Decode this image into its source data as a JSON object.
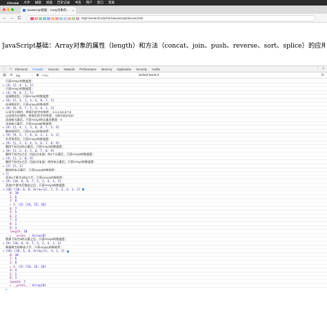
{
  "menubar": {
    "items": [
      "Chrome",
      "文件",
      "编辑",
      "视图",
      "历史记录",
      "书签",
      "用户",
      "窗口",
      "帮助"
    ]
  },
  "tab": {
    "title": "JavaScript基础：Array对象的...",
    "close": "×"
  },
  "nav": {
    "back": "←",
    "forward": "→",
    "reload": "C",
    "url_tail": "/MyFirstHtmlCode/htmlJavaScript/demo6.html",
    "pixel_colors": [
      "#e05a66",
      "#f2a2b0",
      "#8fd19e",
      "#7cc6e8",
      "#b9a1e6",
      "#f0c27a",
      "#e89ab6",
      "#9fd8cb",
      "#c6c6f0",
      "#e3b7a0",
      "#a8d8a0",
      "#d9a0c8"
    ]
  },
  "page": {
    "heading": "JavaScript基础：Array对象的属性（length）和方法（concat、join、push、reverse、sort、splice）的应用"
  },
  "devtools": {
    "tabs": [
      "Elements",
      "Console",
      "Sources",
      "Network",
      "Performance",
      "Memory",
      "Application",
      "Security",
      "Audits"
    ],
    "active_tab": "Console",
    "context": "top",
    "filter_placeholder": "Filter",
    "levels": "Default levels ▾"
  },
  "console": {
    "rows": [
      {
        "kind": "msg",
        "text": "只获Array1的数据是："
      },
      {
        "kind": "obj",
        "tri": "▸",
        "text": "(4) [2, 4, 1, 3]"
      },
      {
        "kind": "msg",
        "text": "只获Array2的数据是："
      },
      {
        "kind": "obj",
        "tri": "▸",
        "text": "(4) [6, 8, 7, 5]"
      },
      {
        "kind": "msg",
        "text": "连接数组后，只获Array3的数据是："
      },
      {
        "kind": "obj",
        "tri": "▸",
        "text": "(8) [2, 4, 1, 3, 6, 8, 7, 5]"
      },
      {
        "kind": "msg",
        "text": "连接数组后，只获Array4的数据是："
      },
      {
        "kind": "obj",
        "tri": "▸",
        "text": "(8) [6, 8, 7, 5, 2, 4, 1, 3]"
      },
      {
        "kind": "msg",
        "text": "以逗号分隔符，拼接后的字符串是：  2,4,1,3,6,8,7,5"
      },
      {
        "kind": "msg",
        "text": "以竖线为分隔符，拼接后的字符串是：  6|8|7|5|2|4|1|3"
      },
      {
        "kind": "msg",
        "text": "添加新元素后，只获Array3的元素总数是：9"
      },
      {
        "kind": "msg",
        "text": "添加新元素后，只获Array3的数据是："
      },
      {
        "kind": "obj",
        "tri": "▸",
        "text": "(9) [2, 4, 1, 3, 6, 8, 7, 5, 9]"
      },
      {
        "kind": "msg",
        "text": "翻转顺序后，只获Array3的数据是："
      },
      {
        "kind": "obj",
        "tri": "▸",
        "text": "(9) [9, 5, 7, 8, 6, 3, 1, 4, 2]"
      },
      {
        "kind": "msg",
        "text": "升序排序后，只获Array3的数据是："
      },
      {
        "kind": "obj",
        "tri": "▸",
        "text": "(9) [1, 2, 3, 4, 5, 6, 7, 8, 9]"
      },
      {
        "kind": "msg",
        "text": "删除下标为2的元素后，只获Array3的数据是："
      },
      {
        "kind": "obj",
        "tri": "▸",
        "text": "(8) [1, 2, 4, 5, 6, 7, 8, 9]"
      },
      {
        "kind": "msg",
        "text": "删除下标为2之后（包括它本身）的4个元素后，只获Array3的数据是："
      },
      {
        "kind": "obj",
        "tri": "▸",
        "text": "(4) [1, 2, 8, 9]"
      },
      {
        "kind": "msg",
        "text": "删除下标为2之后（包括它本身）的所有元素后，只获Array3的数据是："
      },
      {
        "kind": "obj",
        "tri": "▸",
        "text": "(2) [1, 2]"
      },
      {
        "kind": "msg",
        "text": "删除所有元素后，只获Array3的数据是："
      },
      {
        "kind": "obj",
        "tri": "▸",
        "text": "[]"
      },
      {
        "kind": "msg",
        "text": "添加1个数字1和2之后，只获Array4的数据是："
      },
      {
        "kind": "obj",
        "tri": "▸",
        "text": "(9) [10, 6, 8, 7, 5, 2, 4, 1, 3]"
      },
      {
        "kind": "msg",
        "text": "添加3个数字后数组之后，只获Array4的数据是："
      },
      {
        "kind": "obj",
        "tri": "▾",
        "text": "(10) [10, 6, 8, Array(3), 7, 5, 2, 4, 1, 3]",
        "badge": true
      },
      {
        "kind": "child",
        "key": "0:",
        "val": "10"
      },
      {
        "kind": "child",
        "key": "1:",
        "val": "6"
      },
      {
        "kind": "child",
        "key": "2:",
        "val": "8"
      },
      {
        "kind": "child",
        "key": "▸ 3:",
        "val": "(3) [14, 15, 16]"
      },
      {
        "kind": "child",
        "key": "4:",
        "val": "7"
      },
      {
        "kind": "child",
        "key": "5:",
        "val": "5"
      },
      {
        "kind": "child",
        "key": "6:",
        "val": "2"
      },
      {
        "kind": "child",
        "key": "7:",
        "val": "4"
      },
      {
        "kind": "child",
        "key": "8:",
        "val": "1"
      },
      {
        "kind": "child",
        "key": "9:",
        "val": "3"
      },
      {
        "kind": "child",
        "key": "length:",
        "val": "10"
      },
      {
        "kind": "child",
        "key": "▸ __proto__:",
        "val": "Array(0)"
      },
      {
        "kind": "msg",
        "text": "替换下标为3的元素之后，只获Array4的数据是："
      },
      {
        "kind": "obj",
        "tri": "▸",
        "text": "(9) [10, 6, 8, 7, 5, 2, 4, 1, 3]"
      },
      {
        "kind": "msg",
        "text": "替换数字和数组之后，只获Array4的数据是："
      },
      {
        "kind": "obj",
        "tri": "▾",
        "text": "(10) [10, 6, 8, Array(3), 4, 1, 3]",
        "badge": true
      },
      {
        "kind": "child",
        "key": "0:",
        "val": "10"
      },
      {
        "kind": "child",
        "key": "1:",
        "val": "6"
      },
      {
        "kind": "child",
        "key": "2:",
        "val": "8"
      },
      {
        "kind": "child",
        "key": "▸ 3:",
        "val": "(3) [14, 15, 16]"
      },
      {
        "kind": "child",
        "key": "4:",
        "val": "4"
      },
      {
        "kind": "child",
        "key": "5:",
        "val": "1"
      },
      {
        "kind": "child",
        "key": "6:",
        "val": "3"
      },
      {
        "kind": "child",
        "key": "length:",
        "val": "7"
      },
      {
        "kind": "child",
        "key": "▸ __proto__:",
        "val": "Array(0)"
      }
    ],
    "prompt": ">"
  }
}
